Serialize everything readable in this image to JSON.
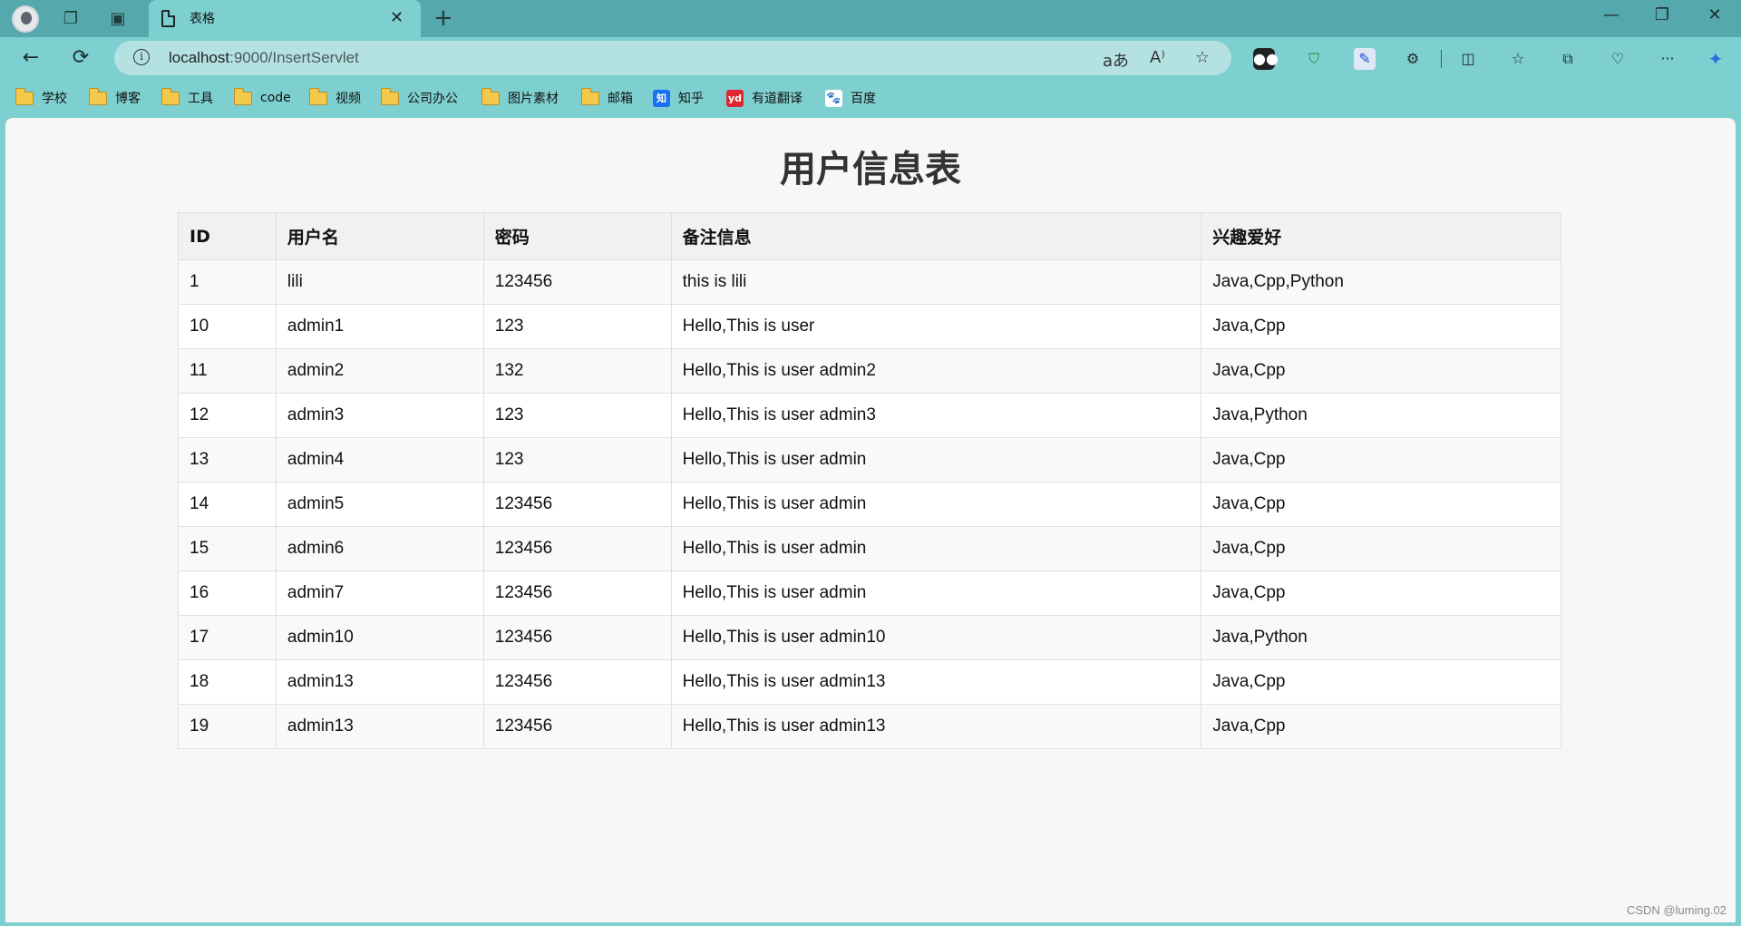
{
  "browser": {
    "tab_title": "表格",
    "url_host": "localhost",
    "url_rest": ":9000/InsertServlet",
    "window_controls": [
      "minimize-icon",
      "restore-icon",
      "close-icon"
    ]
  },
  "bookmarks": [
    {
      "label": "学校",
      "icon": "folder-icon"
    },
    {
      "label": "博客",
      "icon": "folder-icon"
    },
    {
      "label": "工具",
      "icon": "folder-icon"
    },
    {
      "label": "code",
      "icon": "folder-icon"
    },
    {
      "label": "视频",
      "icon": "folder-icon"
    },
    {
      "label": "公司办公",
      "icon": "folder-icon"
    },
    {
      "label": "图片素材",
      "icon": "folder-icon"
    },
    {
      "label": "邮箱",
      "icon": "folder-icon"
    },
    {
      "label": "知乎",
      "icon": "zhihu-icon",
      "badge_text": "知",
      "color": "#1772f6"
    },
    {
      "label": "有道翻译",
      "icon": "youdao-icon",
      "badge_text": "yd",
      "color": "#e0262f"
    },
    {
      "label": "百度",
      "icon": "baidu-icon",
      "badge_text": "🐾",
      "color": "#2932e1"
    }
  ],
  "page": {
    "title": "用户信息表",
    "table": {
      "headers": [
        "ID",
        "用户名",
        "密码",
        "备注信息",
        "兴趣爱好"
      ],
      "rows": [
        [
          "1",
          "lili",
          "123456",
          "this is lili",
          "Java,Cpp,Python"
        ],
        [
          "10",
          "admin1",
          "123",
          "Hello,This is user",
          "Java,Cpp"
        ],
        [
          "11",
          "admin2",
          "132",
          "Hello,This is user admin2",
          "Java,Cpp"
        ],
        [
          "12",
          "admin3",
          "123",
          "Hello,This is user admin3",
          "Java,Python"
        ],
        [
          "13",
          "admin4",
          "123",
          "Hello,This is user admin",
          "Java,Cpp"
        ],
        [
          "14",
          "admin5",
          "123456",
          "Hello,This is user admin",
          "Java,Cpp"
        ],
        [
          "15",
          "admin6",
          "123456",
          "Hello,This is user admin",
          "Java,Cpp"
        ],
        [
          "16",
          "admin7",
          "123456",
          "Hello,This is user admin",
          "Java,Cpp"
        ],
        [
          "17",
          "admin10",
          "123456",
          "Hello,This is user admin10",
          "Java,Python"
        ],
        [
          "18",
          "admin13",
          "123456",
          "Hello,This is user admin13",
          "Java,Cpp"
        ],
        [
          "19",
          "admin13",
          "123456",
          "Hello,This is user admin13",
          "Java,Cpp"
        ]
      ]
    },
    "watermark": "CSDN @luming.02"
  },
  "colors": {
    "titlebar": "#55a8ab",
    "toolbar": "#7ecfd0",
    "omnibox": "#b4e2e3",
    "page_bg": "#f7f7f7"
  }
}
